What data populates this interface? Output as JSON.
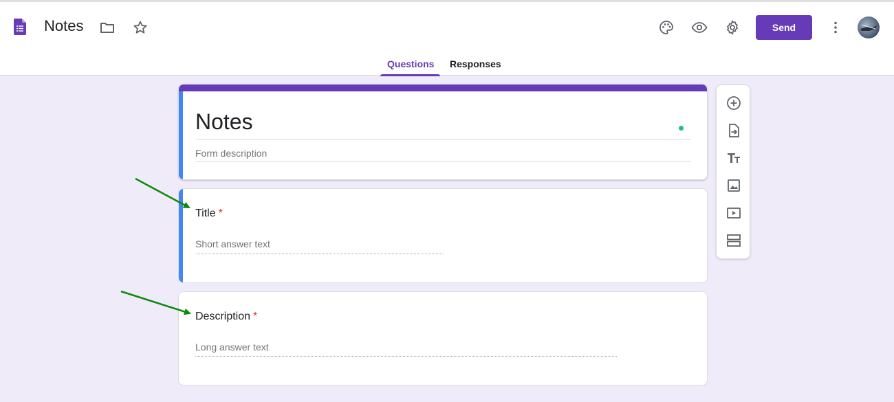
{
  "app": {
    "doc_title": "Notes",
    "app_icon": "forms-icon"
  },
  "toolbar": {
    "icons": [
      "folder-icon",
      "star-icon",
      "palette-icon",
      "eye-icon",
      "gear-icon",
      "more-vert-icon"
    ],
    "send_label": "Send"
  },
  "tabs": {
    "questions": "Questions",
    "responses": "Responses",
    "active": "Questions"
  },
  "form": {
    "title": "Notes",
    "description_placeholder": "Form description"
  },
  "questions": [
    {
      "title": "Title",
      "required": "*",
      "placeholder": "Short answer text",
      "type": "short-answer"
    },
    {
      "title": "Description",
      "required": "*",
      "placeholder": "Long answer text",
      "type": "paragraph"
    }
  ],
  "side_toolbar": {
    "icons": [
      "add-question-icon",
      "import-questions-icon",
      "add-title-icon",
      "add-image-icon",
      "add-video-icon",
      "add-section-icon"
    ]
  },
  "colors": {
    "accent": "#673ab7",
    "background": "#f0ebf8",
    "focus_bar": "#4285f4",
    "required": "#d93025",
    "annotation_arrow": "#0b8a0b"
  }
}
